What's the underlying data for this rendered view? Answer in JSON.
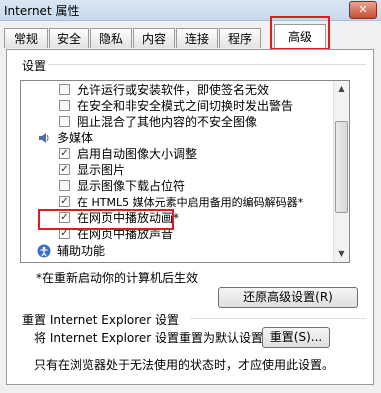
{
  "window": {
    "title": "Internet 属性",
    "close_label": "✕"
  },
  "tabs": [
    {
      "label": "常规"
    },
    {
      "label": "安全"
    },
    {
      "label": "隐私"
    },
    {
      "label": "内容"
    },
    {
      "label": "连接"
    },
    {
      "label": "程序"
    },
    {
      "label": "高级",
      "selected": true
    }
  ],
  "settings": {
    "label": "设置",
    "items": [
      {
        "text": "允许运行或安装软件，即使签名无效",
        "checked": false
      },
      {
        "text": "在安全和非安全模式之间切换时发出警告",
        "checked": false
      },
      {
        "text": "阻止混合了其他内容的不安全图像",
        "checked": false
      },
      {
        "text": "多媒体",
        "category": true,
        "icon": "multimedia-icon"
      },
      {
        "text": "启用自动图像大小调整",
        "checked": true
      },
      {
        "text": "显示图片",
        "checked": true
      },
      {
        "text": "显示图像下载占位符",
        "checked": false
      },
      {
        "text": "在 HTML5 媒体元素中启用备用的编码解码器*",
        "checked": true
      },
      {
        "text": "在网页中播放动画*",
        "checked": true
      },
      {
        "text": "在网页中播放声音",
        "checked": true,
        "highlighted": true
      },
      {
        "text": "辅助功能",
        "category": true,
        "icon": "accessibility-icon"
      }
    ],
    "restart_note": "*在重新启动你的计算机后生效",
    "restore_button": "还原高级设置(R)"
  },
  "reset_section": {
    "heading": "重置 Internet Explorer 设置",
    "description": "将 Internet Explorer 设置重置为默认设置。",
    "reset_button": "重置(S)...",
    "note": "只有在浏览器处于无法使用的状态时，才应使用此设置。"
  },
  "colors": {
    "highlight": "#e21c1c",
    "check": "#333333"
  }
}
